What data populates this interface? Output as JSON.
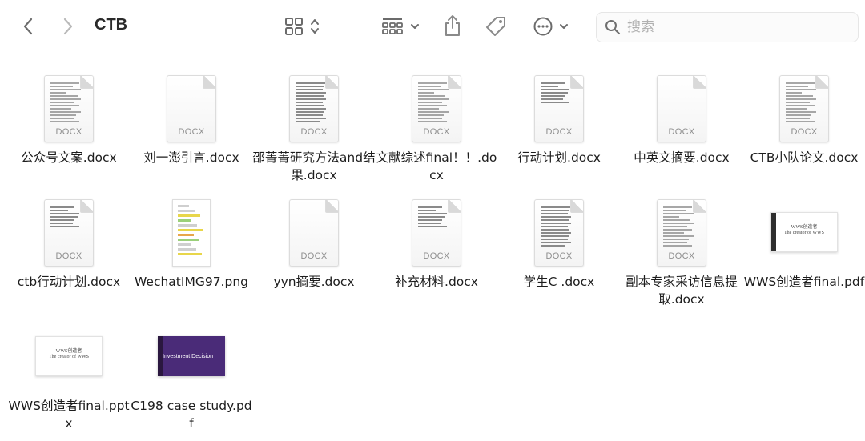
{
  "toolbar": {
    "title": "CTB",
    "back_icon": "chevron-left-icon",
    "forward_icon": "chevron-right-icon",
    "view_icon": "grid-view-icon",
    "group_icon": "group-icon",
    "share_icon": "share-icon",
    "tag_icon": "tag-icon",
    "more_icon": "ellipsis-circle-icon",
    "search_placeholder": "搜索"
  },
  "files": [
    {
      "name": "公众号文案.docx",
      "ext": "DOCX",
      "kind": "doc"
    },
    {
      "name": "刘一澎引言.docx",
      "ext": "DOCX",
      "kind": "doc"
    },
    {
      "name": "邵菁菁研究方法and结果.docx",
      "ext": "DOCX",
      "kind": "doc"
    },
    {
      "name": "文献综述final！！.docx",
      "ext": "DOCX",
      "kind": "doc"
    },
    {
      "name": "行动计划.docx",
      "ext": "DOCX",
      "kind": "doc"
    },
    {
      "name": "中英文摘要.docx",
      "ext": "DOCX",
      "kind": "doc"
    },
    {
      "name": "CTB小队论文.docx",
      "ext": "DOCX",
      "kind": "doc"
    },
    {
      "name": "ctb行动计划.docx",
      "ext": "DOCX",
      "kind": "doc"
    },
    {
      "name": "WechatIMG97.png",
      "ext": "",
      "kind": "png"
    },
    {
      "name": "yyn摘要.docx",
      "ext": "DOCX",
      "kind": "doc"
    },
    {
      "name": "补充材料.docx",
      "ext": "DOCX",
      "kind": "doc"
    },
    {
      "name": "学生C .docx",
      "ext": "DOCX",
      "kind": "doc"
    },
    {
      "name": "副本专家采访信息提取.docx",
      "ext": "DOCX",
      "kind": "doc"
    },
    {
      "name": "WWS创造者final.pdf",
      "ext": "",
      "kind": "pdf",
      "thumb_text": "WWS创造者\nThe creator of WWS"
    },
    {
      "name": "WWS创造者final.pptx",
      "ext": "",
      "kind": "pptx",
      "thumb_text": "WWS创造者\nThe creator of WWS"
    },
    {
      "name": "C198 case study.pdf",
      "ext": "",
      "kind": "purple",
      "thumb_text": "Investment Decision"
    }
  ]
}
